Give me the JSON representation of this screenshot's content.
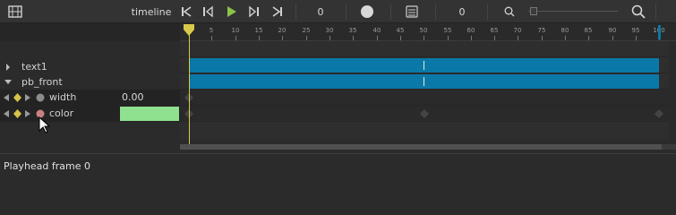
{
  "toolbar": {
    "title": "timeline",
    "frame_value": "0",
    "layer_value": "0",
    "icons": [
      "film-icon",
      "skip-start-icon",
      "step-back-icon",
      "play-icon",
      "step-forward-icon",
      "skip-end-icon",
      "record-icon",
      "layers-icon",
      "zoom-out-icon",
      "zoom-in-icon"
    ],
    "colors": {
      "play": "#8bc34a",
      "accent": "#0a79a8"
    }
  },
  "tracks": [
    {
      "label": "text1",
      "expanded": false
    },
    {
      "label": "pb_front",
      "expanded": true
    }
  ],
  "properties": [
    {
      "label": "width",
      "value": "0.00",
      "dot_color": "#8c8c8c"
    },
    {
      "label": "color",
      "value": "",
      "dot_color": "#c98080",
      "swatch_color": "#8fe08f"
    }
  ],
  "ruler": {
    "ticks": [
      "5",
      "10",
      "15",
      "20",
      "25",
      "30",
      "35",
      "40",
      "45",
      "50",
      "55",
      "60",
      "65",
      "70",
      "75",
      "80",
      "85",
      "90",
      "95",
      "100"
    ]
  },
  "playhead": {
    "frame": 0
  },
  "status": {
    "text": "Playhead frame 0"
  }
}
